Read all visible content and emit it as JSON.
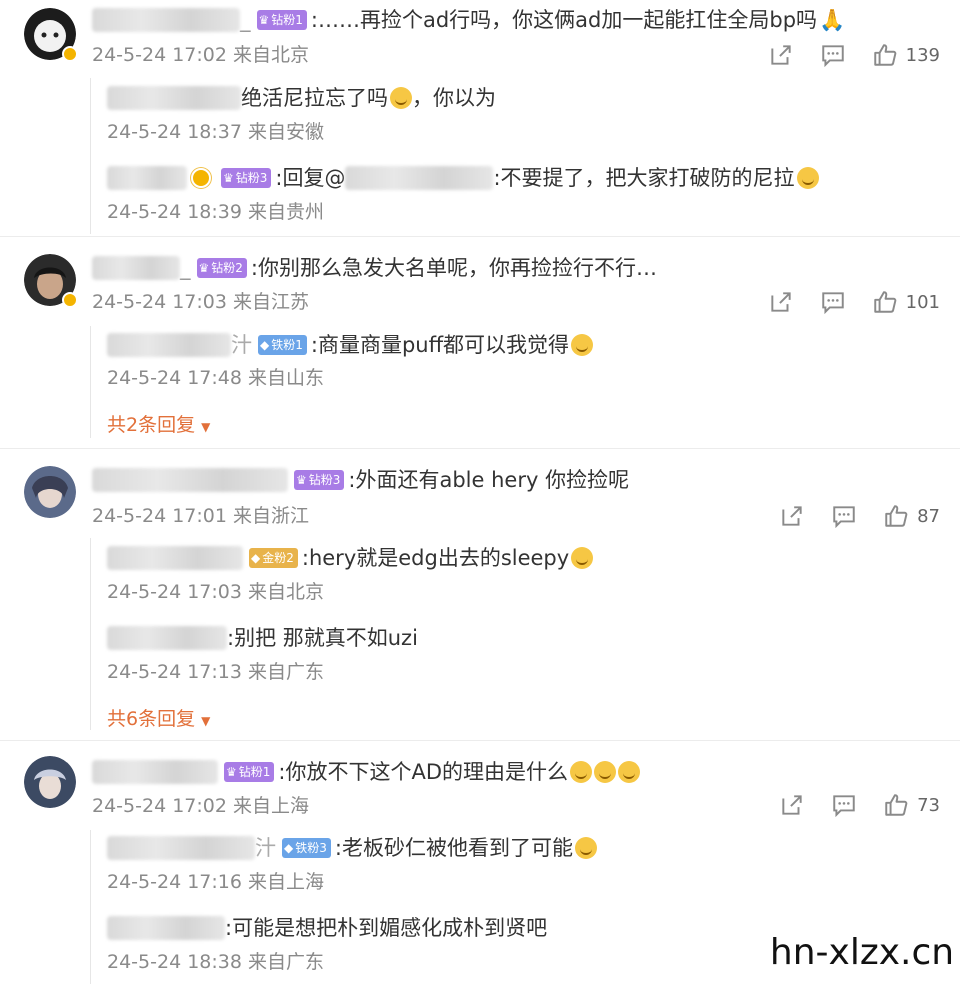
{
  "colors": {
    "accent": "#e2703a",
    "meta": "#8a8a8a",
    "badge_purple": "#a87ce6",
    "badge_blue": "#6aa4e8",
    "badge_gold": "#e8b34b"
  },
  "comments": [
    {
      "badge": "钻粉1",
      "text": ":……再捡个ad行吗，你这俩ad加一起能扛住全局bp吗",
      "meta": "24-5-24 17:02 来自北京",
      "likes": "139",
      "replies": [
        {
          "text": "绝活尼拉忘了吗",
          "tail": "，你以为",
          "meta": "24-5-24 18:37 来自安徽"
        },
        {
          "badge": "钻粉3",
          "prefix": ":回复@",
          "text": ":不要提了，把大家打破防的尼拉",
          "meta": "24-5-24 18:39 来自贵州"
        }
      ]
    },
    {
      "badge": "钻粉2",
      "text": ":你别那么急发大名单呢，你再捡捡行不行…",
      "meta": "24-5-24 17:03 来自江苏",
      "likes": "101",
      "replies": [
        {
          "badge": "铁粉1",
          "text": ":商量商量puff都可以我觉得",
          "meta": "24-5-24 17:48 来自山东"
        }
      ],
      "more": "共2条回复"
    },
    {
      "badge": "钻粉3",
      "text": ":外面还有able hery 你捡捡呢",
      "meta": "24-5-24 17:01 来自浙江",
      "likes": "87",
      "replies": [
        {
          "badge": "金粉2",
          "text": ":hery就是edg出去的sleepy",
          "meta": "24-5-24 17:03 来自北京"
        },
        {
          "text": ":别把 那就真不如uzi",
          "meta": "24-5-24 17:13 来自广东"
        }
      ],
      "more": "共6条回复"
    },
    {
      "badge": "钻粉1",
      "text": ":你放不下这个AD的理由是什么",
      "meta": "24-5-24 17:02 来自上海",
      "likes": "73",
      "replies": [
        {
          "badge": "铁粉3",
          "text": ":老板砂仁被他看到了可能",
          "meta": "24-5-24 17:16 来自上海"
        },
        {
          "text": ":可能是想把朴到媚感化成朴到贤吧",
          "meta": "24-5-24 18:38 来自广东"
        }
      ]
    }
  ],
  "watermark": "hn-xlzx.cn"
}
